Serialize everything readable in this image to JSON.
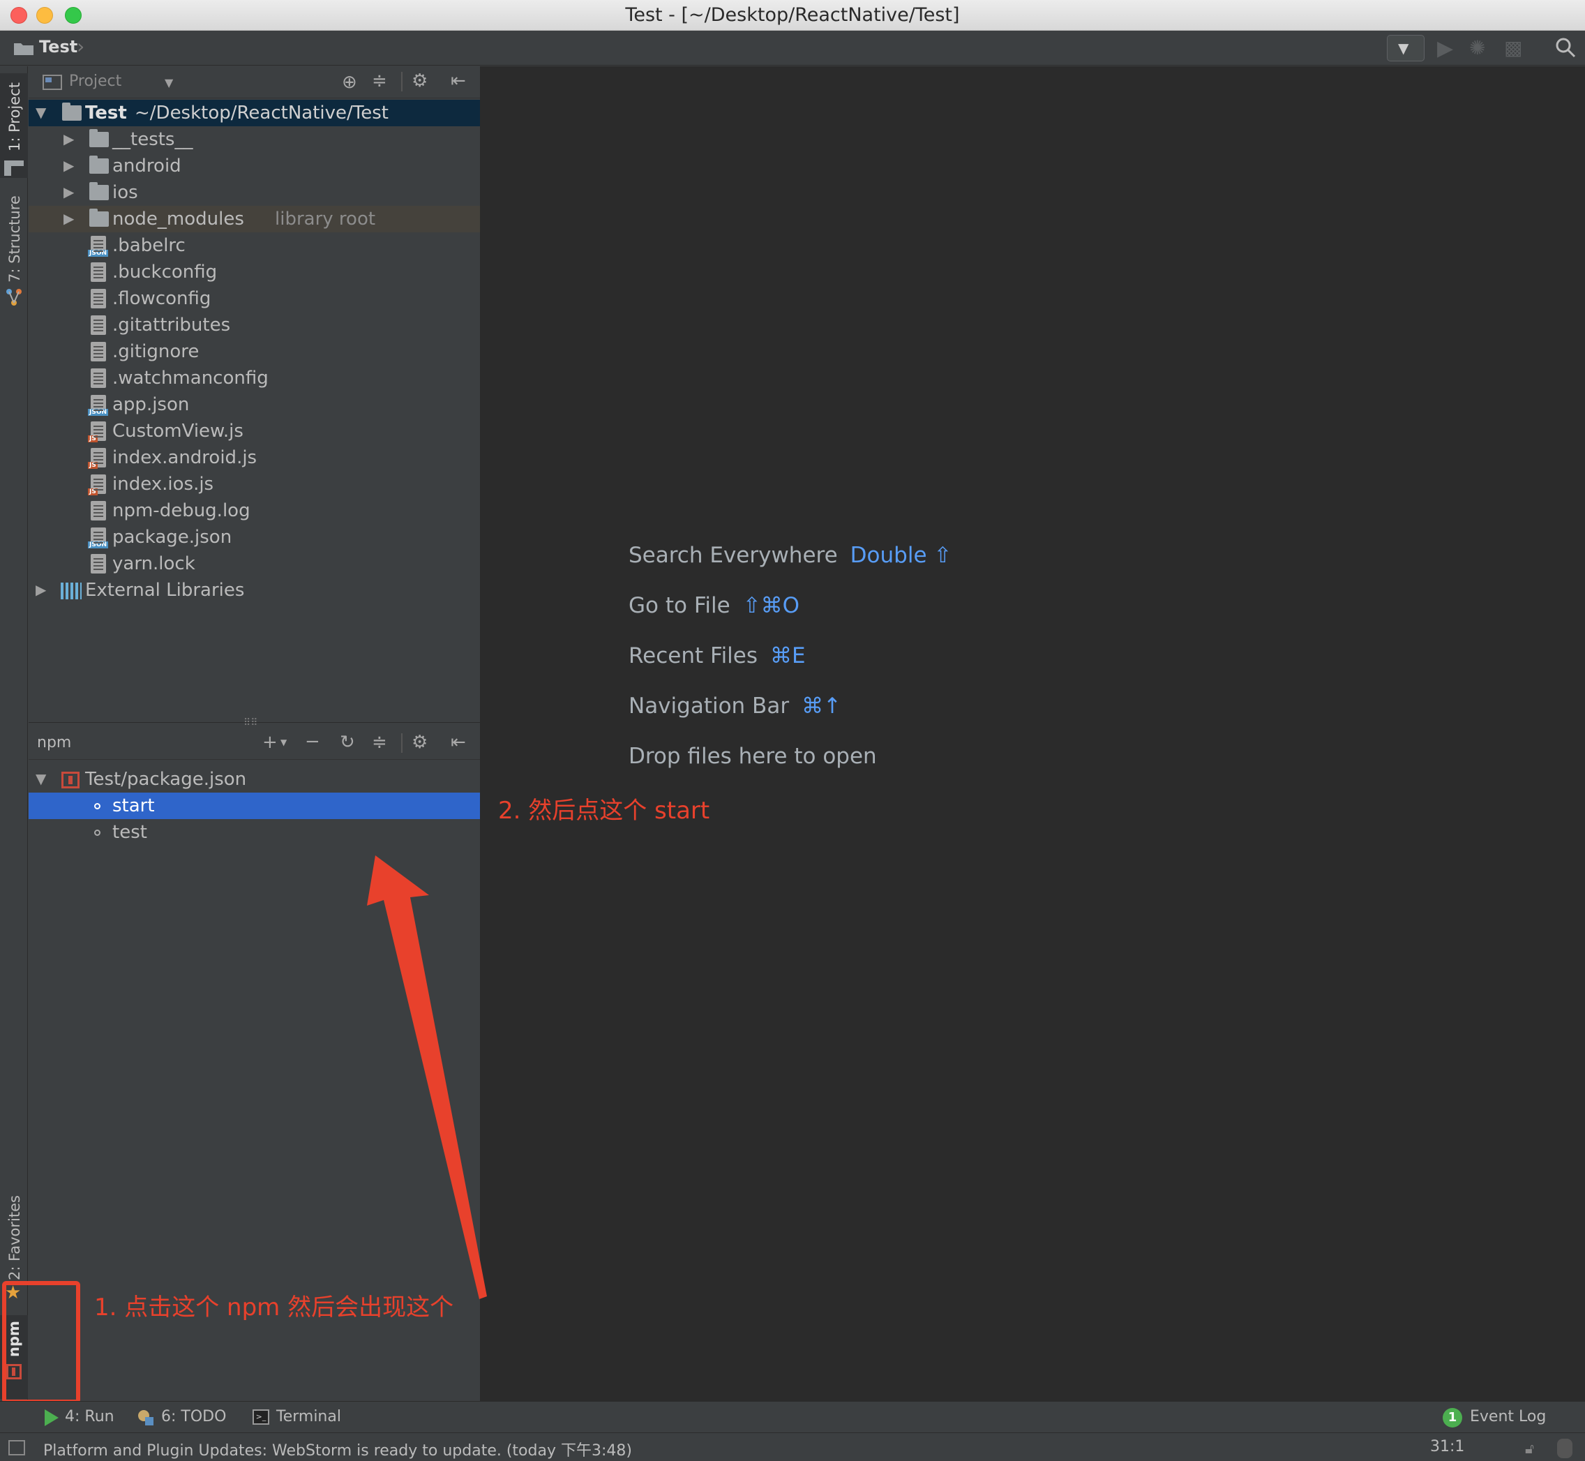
{
  "window": {
    "title": "Test - [~/Desktop/ReactNative/Test]"
  },
  "navbar": {
    "project": "Test"
  },
  "stripe": {
    "project_tab": "1: Project",
    "structure_tab": "7: Structure",
    "favorites_tab": "2: Favorites",
    "npm_tab": "npm"
  },
  "project_panel": {
    "view_label": "Project",
    "root": {
      "name": "Test",
      "path": "~/Desktop/ReactNative/Test"
    },
    "items": [
      {
        "name": "__tests__",
        "type": "folder"
      },
      {
        "name": "android",
        "type": "folder"
      },
      {
        "name": "ios",
        "type": "folder"
      },
      {
        "name": "node_modules",
        "type": "folder",
        "note": "library root"
      },
      {
        "name": ".babelrc",
        "type": "json"
      },
      {
        "name": ".buckconfig",
        "type": "file"
      },
      {
        "name": ".flowconfig",
        "type": "file"
      },
      {
        "name": ".gitattributes",
        "type": "file"
      },
      {
        "name": ".gitignore",
        "type": "file"
      },
      {
        "name": ".watchmanconfig",
        "type": "file"
      },
      {
        "name": "app.json",
        "type": "json"
      },
      {
        "name": "CustomView.js",
        "type": "js"
      },
      {
        "name": "index.android.js",
        "type": "js"
      },
      {
        "name": "index.ios.js",
        "type": "js"
      },
      {
        "name": "npm-debug.log",
        "type": "file"
      },
      {
        "name": "package.json",
        "type": "json"
      },
      {
        "name": "yarn.lock",
        "type": "file"
      }
    ],
    "external": "External Libraries"
  },
  "npm_panel": {
    "label": "npm",
    "package": "Test/package.json",
    "scripts": [
      "start",
      "test"
    ],
    "selected": "start"
  },
  "editor_hints": [
    {
      "label": "Search Everywhere",
      "key": "Double ⇧"
    },
    {
      "label": "Go to File",
      "key": "⇧⌘O"
    },
    {
      "label": "Recent Files",
      "key": "⌘E"
    },
    {
      "label": "Navigation Bar",
      "key": "⌘↑"
    },
    {
      "label": "Drop files here to open",
      "key": ""
    }
  ],
  "annotations": {
    "step1": "1. 点击这个 npm 然后会出现这个",
    "step2": "2. 然后点这个 start",
    "color": "#e8412c"
  },
  "toolbar": {
    "run": "4: Run",
    "todo": "6: TODO",
    "terminal": "Terminal",
    "event_log": "Event Log",
    "event_count": "1"
  },
  "status": {
    "message": "Platform and Plugin Updates: WebStorm is ready to update. (today 下午3:48)",
    "position": "31:1"
  },
  "colors": {
    "selection": "#2f65ca",
    "editor_bg": "#2b2b2b",
    "panel_bg": "#3c3f41",
    "hint_key": "#589df6"
  }
}
